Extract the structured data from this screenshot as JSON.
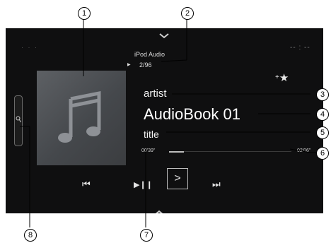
{
  "header": {
    "source_label": "iPod Audio",
    "track_count": "2/96",
    "clock": "-- : --",
    "status_dots": "· · ·"
  },
  "now_playing": {
    "artist": "artist",
    "album": "AudioBook 01",
    "title": "title",
    "elapsed": "00'39\"",
    "total": "02'06\"",
    "progress_fraction": 0.12
  },
  "controls": {
    "favorite_label": "★",
    "favorite_plus": "+",
    "prev_label": "⏮",
    "play_pause_label": "▶❙❙",
    "next_label": "⏭",
    "expand_label": ">"
  },
  "callouts": [
    "1",
    "2",
    "3",
    "4",
    "5",
    "6",
    "7",
    "8"
  ],
  "icons": [
    "music-note-icon",
    "search-icon",
    "chevron-up-icon",
    "chevron-down-icon",
    "star-icon"
  ]
}
